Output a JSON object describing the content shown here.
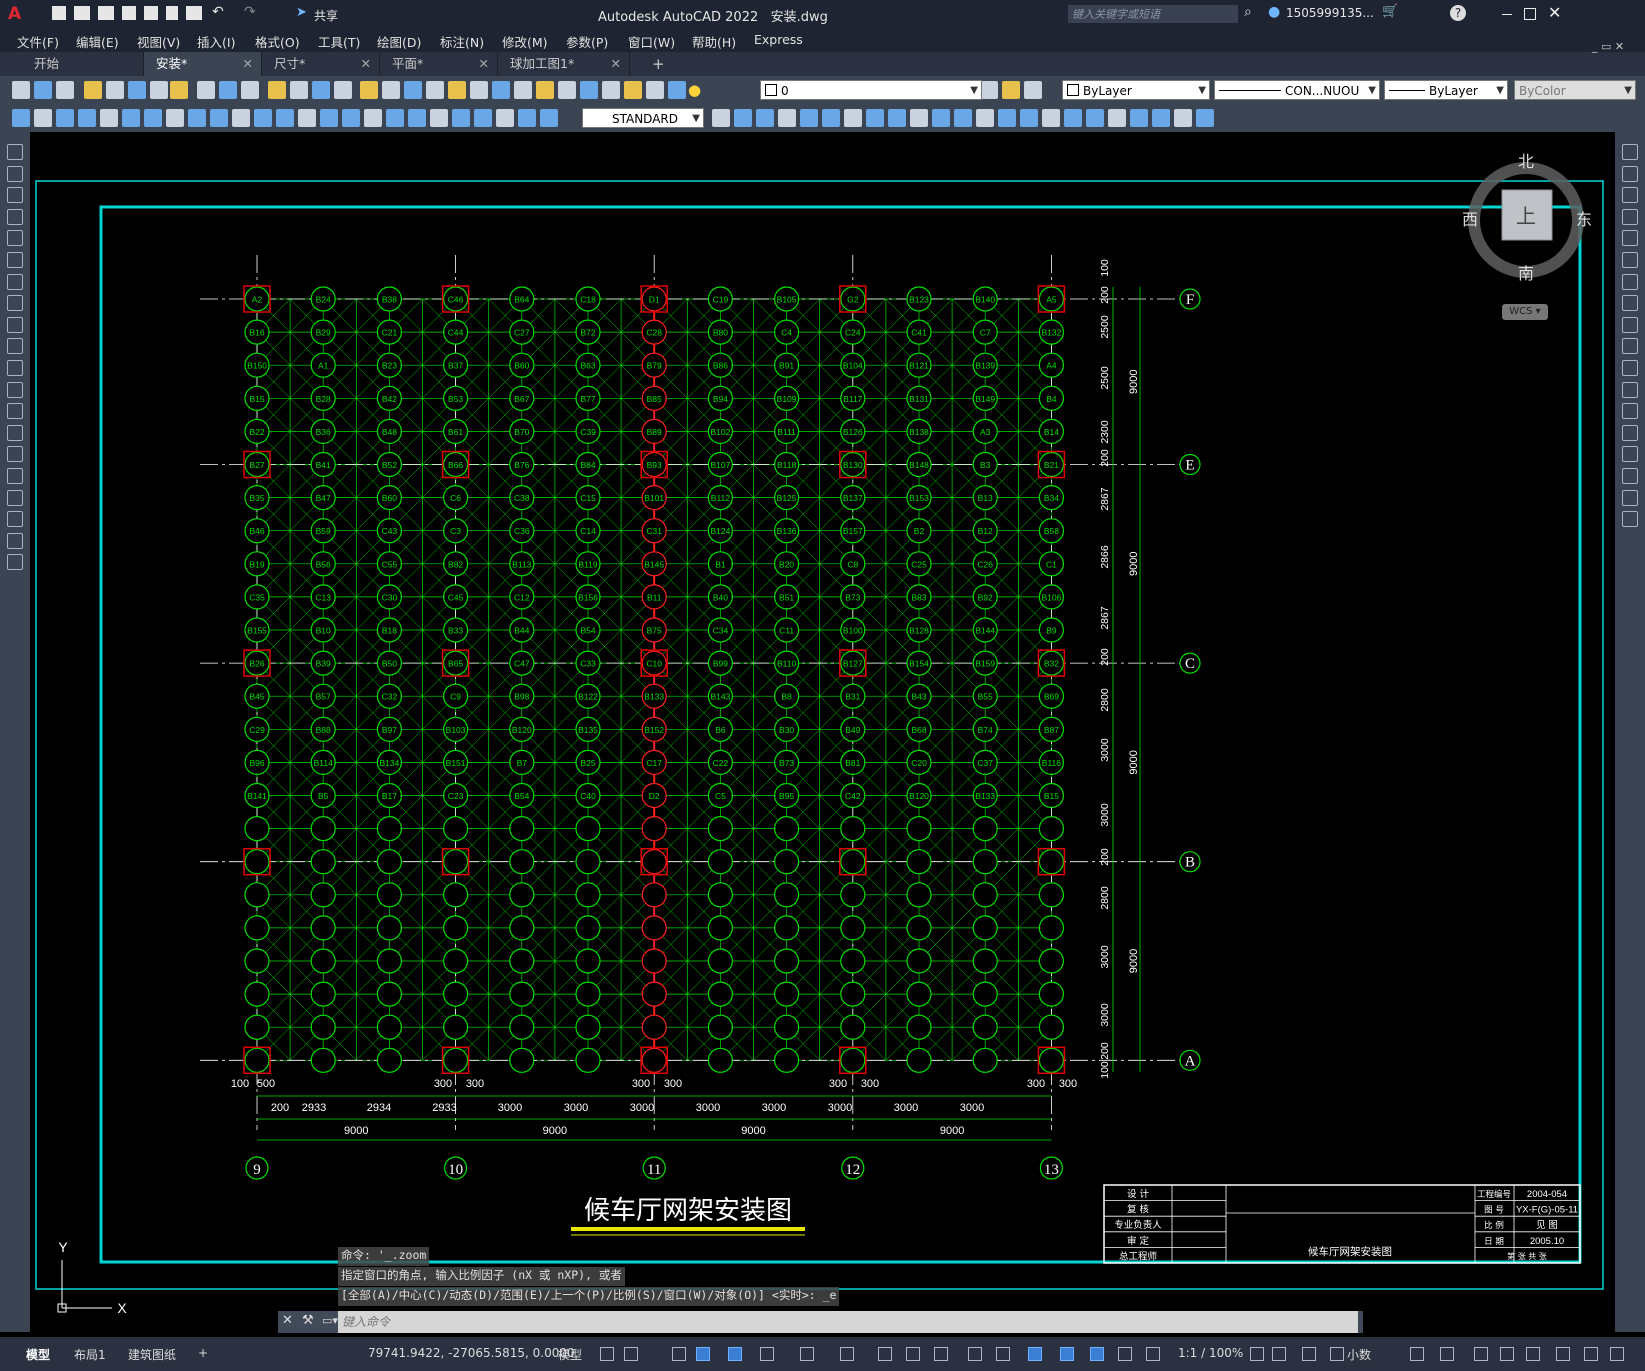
{
  "app": {
    "title": "Autodesk AutoCAD 2022",
    "file": "安装.dwg",
    "share_label": "共享",
    "search_placeholder": "键入关键字或短语",
    "user": "1505999135..."
  },
  "menu": [
    "文件(F)",
    "编辑(E)",
    "视图(V)",
    "插入(I)",
    "格式(O)",
    "工具(T)",
    "绘图(D)",
    "标注(N)",
    "修改(M)",
    "参数(P)",
    "窗口(W)",
    "帮助(H)",
    "Express"
  ],
  "tabs": [
    {
      "label": "开始",
      "closable": false
    },
    {
      "label": "安装*",
      "closable": true,
      "active": true
    },
    {
      "label": "尺寸*",
      "closable": true
    },
    {
      "label": "平面*",
      "closable": true
    },
    {
      "label": "球加工图1*",
      "closable": true
    }
  ],
  "toolbar": {
    "layer_value": "0",
    "color_value": "ByLayer",
    "linetype_value": "CON...NUOU",
    "lineweight_value": "ByLayer",
    "plotstyle_value": "ByColor",
    "textstyle_value": "STANDARD"
  },
  "viewcube": {
    "north": "北",
    "south": "南",
    "east": "东",
    "west": "西",
    "top": "上",
    "wcs": "WCS"
  },
  "drawing": {
    "title": "候车厅网架安装图",
    "colors": {
      "grid": "#00e000",
      "frame": "#00d5d5",
      "axis": "#ffffff",
      "center": "#ff2020",
      "highlight": "#e00000",
      "title_underline": "#e6e600"
    },
    "axis_bottom": [
      "9",
      "10",
      "11",
      "12",
      "13"
    ],
    "axis_right": [
      "F",
      "E",
      "C",
      "B",
      "A"
    ],
    "dims_bottom_row1": [
      "100",
      "500",
      "300",
      "300",
      "300",
      "300",
      "300",
      "300",
      "300",
      "300"
    ],
    "dims_bottom_row2": [
      "200",
      "2933",
      "2934",
      "2933",
      "3000",
      "3000",
      "3000",
      "3000",
      "3000",
      "3000",
      "3000",
      "3000"
    ],
    "dims_bottom_row3": [
      "9000",
      "9000",
      "9000",
      "9000"
    ],
    "dims_right_small": [
      "100",
      "200",
      "2500",
      "2500",
      "2300",
      "200",
      "2867",
      "2866",
      "2867",
      "200",
      "2800",
      "3000",
      "3000",
      "200",
      "2800",
      "3000",
      "3000",
      "200",
      "100"
    ],
    "dims_right_big": [
      "9000",
      "9000",
      "9000",
      "9000"
    ],
    "node_labels": [
      "A2",
      "B24",
      "B38",
      "C46",
      "B64",
      "C18",
      "D1",
      "C19",
      "B105",
      "G2",
      "B123",
      "B140",
      "A5",
      "B16",
      "B29",
      "C21",
      "C44",
      "C27",
      "B72",
      "C28",
      "B80",
      "C4",
      "C24",
      "C41",
      "C7",
      "B132",
      "B150",
      "A1",
      "B23",
      "B37",
      "B60",
      "B63",
      "B79",
      "B86",
      "B91",
      "B104",
      "B121",
      "B139",
      "A4",
      "B15",
      "B28",
      "B42",
      "B53",
      "B67",
      "B77",
      "B85",
      "B94",
      "B109",
      "B117",
      "B131",
      "B149",
      "B4",
      "B22",
      "B36",
      "B48",
      "B61",
      "B70",
      "C39",
      "B89",
      "B102",
      "B111",
      "B126",
      "B138",
      "A3",
      "B14",
      "B27",
      "B41",
      "B52",
      "B66",
      "B76",
      "B84",
      "B93",
      "B107",
      "B118",
      "B130",
      "B148",
      "B3",
      "B21",
      "B35",
      "B47",
      "B60",
      "C6",
      "C38",
      "C15",
      "B101",
      "B112",
      "B125",
      "B137",
      "B153",
      "B13",
      "B34",
      "B46",
      "B59",
      "C43",
      "C3",
      "C36",
      "C14",
      "C31",
      "B124",
      "B136",
      "B157",
      "B2",
      "B12",
      "B58",
      "B19",
      "B56",
      "C55",
      "B82",
      "B113",
      "B119",
      "B145",
      "B1",
      "B20",
      "C8",
      "C25",
      "C26",
      "C1",
      "C35",
      "C13",
      "C30",
      "C45",
      "C12",
      "B156",
      "B11",
      "B40",
      "B51",
      "B73",
      "B83",
      "B92",
      "B106",
      "B155",
      "B10",
      "B18",
      "B33",
      "B44",
      "B54",
      "B75",
      "C34",
      "C11",
      "B100",
      "B128",
      "B144",
      "B9",
      "B26",
      "B39",
      "B50",
      "B65",
      "C47",
      "C33",
      "C10",
      "B99",
      "B110",
      "B127",
      "B154",
      "B159",
      "B32",
      "B45",
      "B57",
      "C32",
      "C9",
      "B98",
      "B122",
      "B133",
      "B143",
      "B8",
      "B31",
      "B43",
      "B55",
      "B69",
      "C29",
      "B88",
      "B97",
      "B103",
      "B120",
      "B135",
      "B152",
      "B6",
      "B30",
      "B49",
      "B68",
      "B74",
      "B87",
      "B96",
      "B114",
      "B134",
      "B151",
      "B7",
      "B25",
      "C17",
      "C22",
      "B73",
      "B81",
      "C20",
      "C37",
      "B116",
      "B141",
      "B5",
      "B17",
      "C23",
      "B54",
      "C40",
      "D2",
      "C5",
      "B95",
      "C42",
      "B120",
      "B133",
      "B15"
    ],
    "title_block": {
      "left_labels": [
        "设    计",
        "复    核",
        "专业负责人",
        "审    定",
        "总工程师"
      ],
      "title": "候车厅网架安装图",
      "right_labels": [
        "工程编号",
        "图    号",
        "比    例",
        "日    期"
      ],
      "right_values": [
        "2004-054",
        "YX-F(G)-05-11",
        "见    图",
        "2005.10"
      ],
      "bottom": "第  张    共  张"
    }
  },
  "command": {
    "history": [
      "命令: '_.zoom",
      "指定窗口的角点, 输入比例因子 (nX 或 nXP), 或者",
      "[全部(A)/中心(C)/动态(D)/范围(E)/上一个(P)/比例(S)/窗口(W)/对象(O)] <实时>: _e"
    ],
    "placeholder": "键入命令"
  },
  "ucs": {
    "x": "X",
    "y": "Y"
  },
  "status": {
    "layout_tabs": [
      "模型",
      "布局1",
      "建筑图纸"
    ],
    "coords": "79741.9422, -27065.5815, 0.0000",
    "model": "模型",
    "scale": "1:1 / 100%",
    "units": "小数"
  }
}
